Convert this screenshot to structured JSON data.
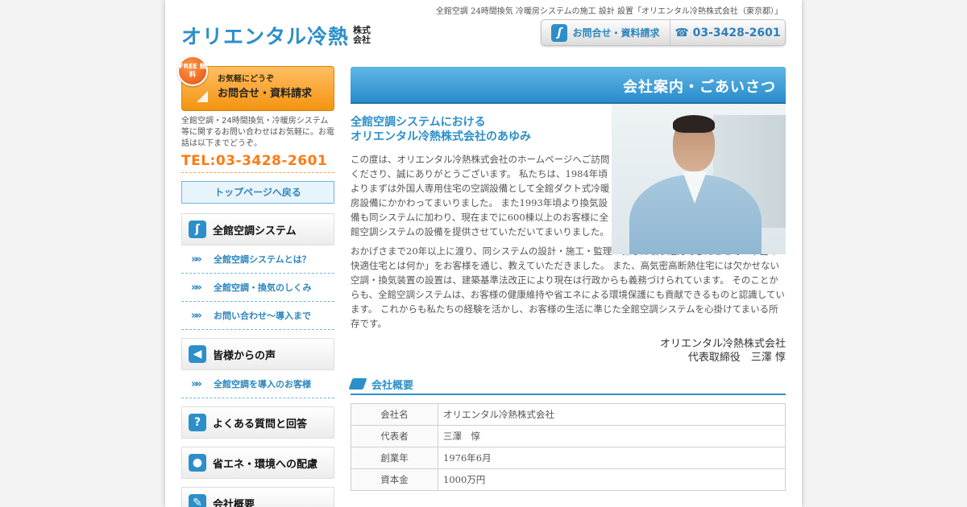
{
  "header": {
    "tagline": "全館空調 24時間換気 冷暖房システムの施工 設計 設置「オリエンタル冷熱株式会社（東京都）」",
    "logo_text": "オリエンタル冷熱",
    "logo_suffix": "株式会社",
    "contact_label": "お問合せ・資料請求",
    "tel_label": "☎ 03-3428-2601"
  },
  "sidebar": {
    "free_badge": "FREE 無料",
    "banner_sub": "お気軽にどうぞ",
    "banner_main": "お問合せ・資料請求",
    "note": "全館空調・24時間換気・冷暖房システム等に関するお問い合わせはお気軽に。お電話は以下までどうぞ。",
    "tel": "TEL:03-3428-2601",
    "top_button": "トップページへ戻る",
    "menu": {
      "zenkan": "全館空調システム",
      "zenkan_items": [
        "全館空調システムとは？",
        "全館空調・換気のしくみ",
        "お問い合わせ〜導入まで"
      ],
      "voice": "皆様からの声",
      "voice_items": [
        "全館空調を導入のお客様"
      ],
      "faq": "よくある質問と回答",
      "eco": "省エネ・環境への配慮",
      "company": "会社概要"
    }
  },
  "main": {
    "heading": "会社案内・ごあいさつ",
    "subtitle_line1": "全館空調システムにおける",
    "subtitle_line2": "オリエンタル冷熱株式会社のあゆみ",
    "paragraph1": "この度は、オリエンタル冷熱株式会社のホームページへご訪問くださり、誠にありがとうございます。 私たちは、1984年頃よりまずは外国人専用住宅の空調設備として全館ダクト式冷暖房設備にかかわってまいりました。 また1993年頃より換気設備も同システムに加わり、現在までに600棟以上のお客様に全館空調システムの設備を提供させていただいてまいりました。",
    "paragraph2": "おかげさまで20年以上に渡り、同システムの設計・施工・監理・保守に取り組んできたことで「本当の快適住宅とは何か」をお客様を通じ、教えていただきました。 また、高気密高断熱住宅には欠かせない空調・換気装置の設置は、建築基準法改正により現在は行政からも義務づけられています。 そのことからも、全館空調システムは、お客様の健康維持や省エネによる環境保護にも貢献できるものと認識しています。 これからも私たちの経験を活かし、お客様の生活に準じた全館空調システムを心掛けてまいる所存です。",
    "sign_company": "オリエンタル冷熱株式会社",
    "sign_person": "代表取締役　三澤 惇",
    "overview_title": "会社概要",
    "table": [
      {
        "key": "会社名",
        "value": "オリエンタル冷熱株式会社"
      },
      {
        "key": "代表者",
        "value": "三澤　惇"
      },
      {
        "key": "創業年",
        "value": "1976年6月"
      },
      {
        "key": "資本金",
        "value": "1000万円"
      }
    ]
  },
  "colors": {
    "accent": "#2c8fc9",
    "orange": "#ff7a12"
  }
}
